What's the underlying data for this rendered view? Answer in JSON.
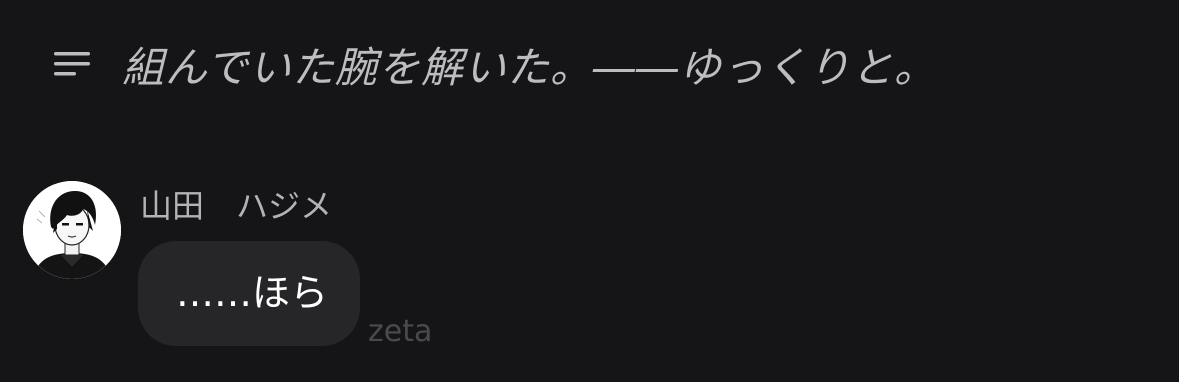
{
  "narration": {
    "icon": "menu-lines-icon",
    "text": "組んでいた腕を解いた。――ゆっくりと。"
  },
  "message": {
    "avatar_icon": "character-portrait-icon",
    "sender": "山田　ハジメ",
    "text": "……ほら"
  },
  "watermark": {
    "text": "zeta"
  },
  "colors": {
    "background": "#151517",
    "bubble": "#262628",
    "narration_text": "#bdbdbf",
    "message_text": "#ffffff"
  }
}
